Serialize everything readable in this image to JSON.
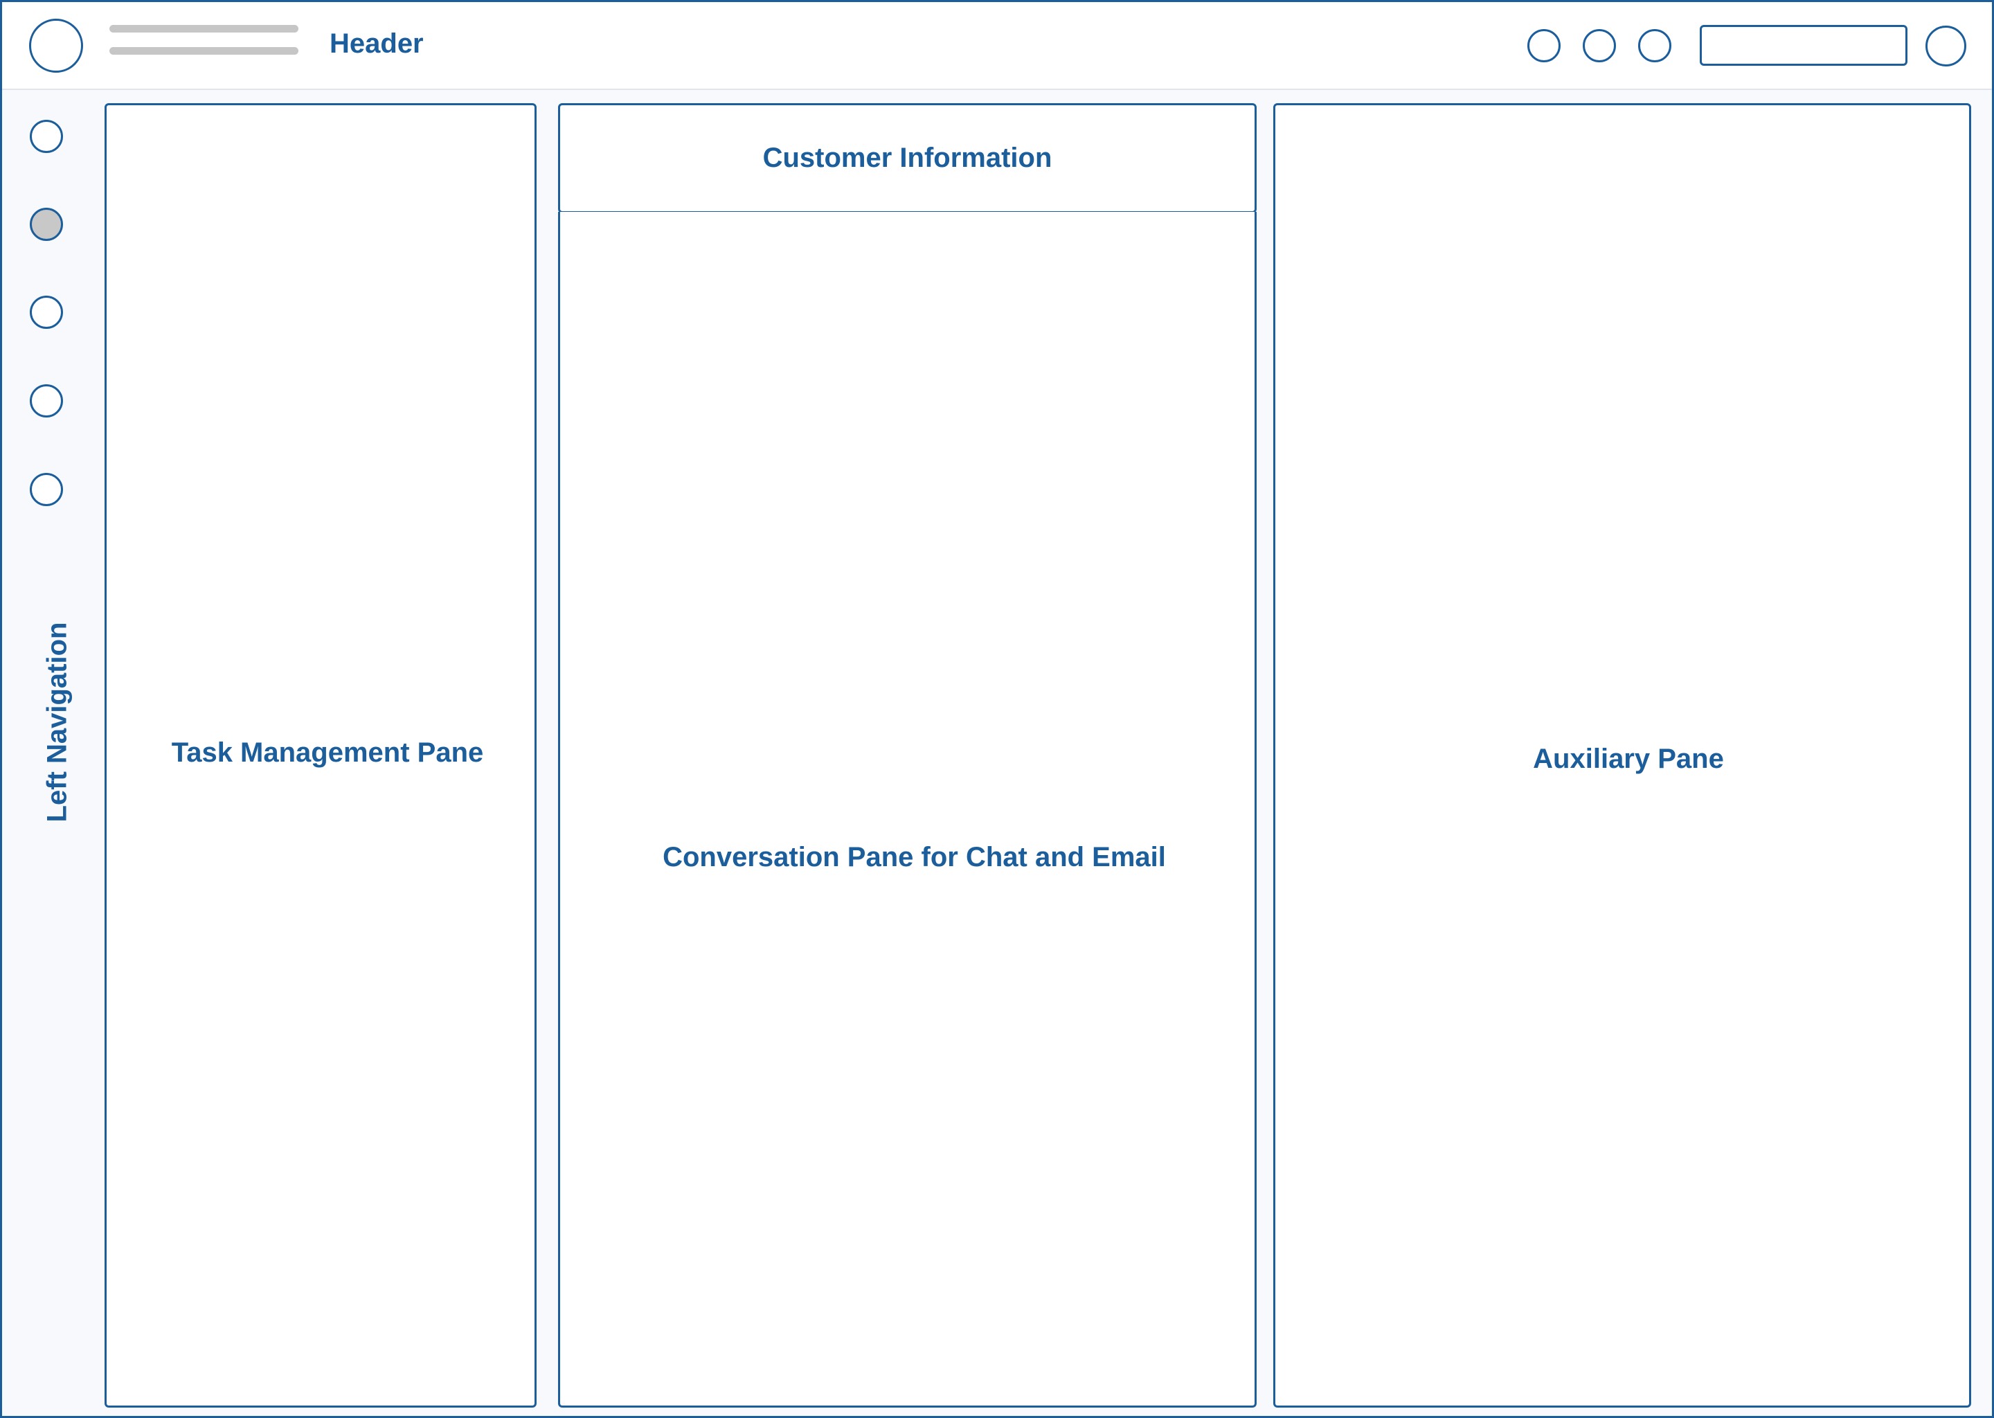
{
  "header": {
    "title": "Header",
    "logo_icon": "logo-circle-icon",
    "icons": [
      "circle-icon",
      "circle-icon",
      "circle-icon"
    ],
    "search_placeholder": "",
    "avatar_icon": "avatar-circle-icon"
  },
  "left_nav": {
    "label": "Left Navigation",
    "items": [
      {
        "icon": "nav-circle-icon",
        "selected": false
      },
      {
        "icon": "nav-circle-icon",
        "selected": true
      },
      {
        "icon": "nav-circle-icon",
        "selected": false
      },
      {
        "icon": "nav-circle-icon",
        "selected": false
      },
      {
        "icon": "nav-circle-icon",
        "selected": false
      }
    ]
  },
  "panes": {
    "task": {
      "label": "Task Management Pane"
    },
    "customer": {
      "label": "Customer Information"
    },
    "conversation": {
      "label": "Conversation Pane for Chat and Email"
    },
    "auxiliary": {
      "label": "Auxiliary Pane"
    }
  },
  "colors": {
    "accent": "#1b5e9b",
    "placeholder_gray": "#c6c6c6",
    "selected_fill": "#c8c8c8",
    "background": "#f8f9fc"
  }
}
